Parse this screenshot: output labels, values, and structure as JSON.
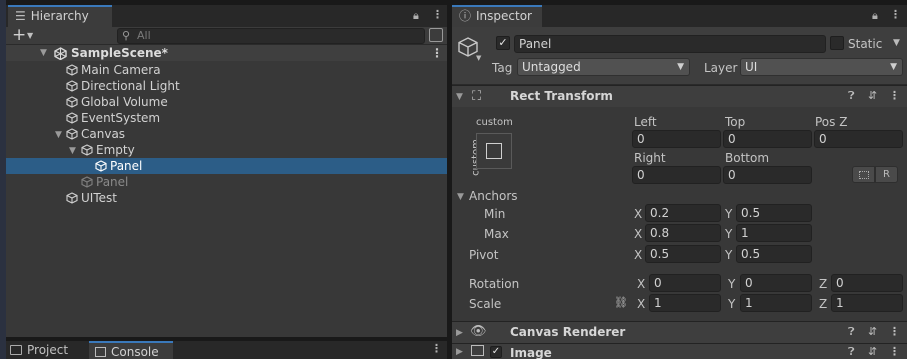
{
  "hierarchy": {
    "tab_label": "Hierarchy",
    "search_placeholder": "All",
    "scene": "SampleScene*",
    "items": [
      {
        "label": "Main Camera"
      },
      {
        "label": "Directional Light"
      },
      {
        "label": "Global Volume"
      },
      {
        "label": "EventSystem"
      },
      {
        "label": "Canvas"
      },
      {
        "label": "Empty"
      },
      {
        "label": "Panel"
      },
      {
        "label": "Panel"
      },
      {
        "label": "UITest"
      }
    ]
  },
  "bottom_tabs": {
    "project": "Project",
    "console": "Console"
  },
  "inspector": {
    "tab_label": "Inspector",
    "object_name": "Panel",
    "static_label": "Static",
    "tag_label": "Tag",
    "tag_value": "Untagged",
    "layer_label": "Layer",
    "layer_value": "UI",
    "rect_transform": {
      "title": "Rect Transform",
      "anchor_preset_top": "custom",
      "anchor_preset_side": "custom",
      "left_label": "Left",
      "left": "0",
      "top_label": "Top",
      "top": "0",
      "posz_label": "Pos Z",
      "posz": "0",
      "right_label": "Right",
      "right": "0",
      "bottom_label": "Bottom",
      "bottom": "0",
      "r_button": "R",
      "anchors_label": "Anchors",
      "min_label": "Min",
      "min_x": "0.2",
      "min_y": "0.5",
      "max_label": "Max",
      "max_x": "0.8",
      "max_y": "1",
      "pivot_label": "Pivot",
      "pivot_x": "0.5",
      "pivot_y": "0.5",
      "rotation_label": "Rotation",
      "rot_x": "0",
      "rot_y": "0",
      "rot_z": "0",
      "scale_label": "Scale",
      "scale_x": "1",
      "scale_y": "1",
      "scale_z": "1",
      "x": "X",
      "y": "Y",
      "z": "Z"
    },
    "canvas_renderer_title": "Canvas Renderer",
    "image_title": "Image"
  },
  "colors": {
    "accent": "#3a79bb",
    "selection": "#2c5d87",
    "panel": "#383838"
  }
}
